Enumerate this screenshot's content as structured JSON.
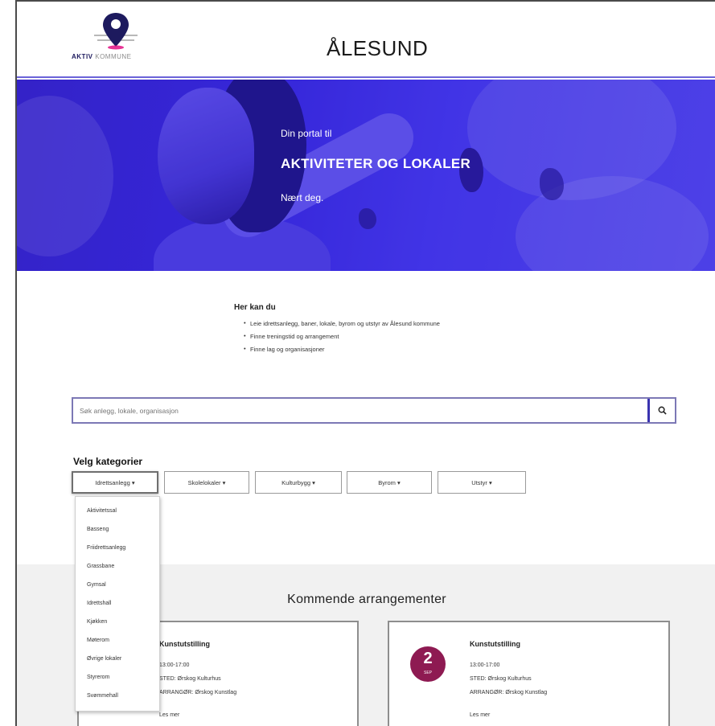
{
  "header": {
    "logo_brand": "AKTIV",
    "logo_sub": "KOMMUNE",
    "site_title": "ÅLESUND"
  },
  "hero": {
    "subtitle": "Din portal til",
    "title": "AKTIVITETER OG LOKALER",
    "tagline": "Nært deg."
  },
  "intro": {
    "heading": "Her kan du",
    "items": [
      "Leie idrettsanlegg, baner, lokale, byrom og utstyr av Ålesund kommune",
      "Finne treningstid og arrangement",
      "Finne lag og organisasjoner"
    ]
  },
  "search": {
    "placeholder": "Søk anlegg, lokale, organisasjon",
    "icon": "search-icon"
  },
  "categories": {
    "heading": "Velg kategorier",
    "buttons": [
      "Idrettsanlegg ▾",
      "Skolelokaler ▾",
      "Kulturbygg ▾",
      "Byrom ▾",
      "Utstyr ▾"
    ],
    "dropdown_items": [
      "Aktivitetssal",
      "Basseng",
      "Friidrettsanlegg",
      "Grassbane",
      "Gymsal",
      "Idrettshall",
      "Kjøkken",
      "Møterom",
      "Øvrige lokaler",
      "Styrerom",
      "Svømmehall"
    ]
  },
  "events": {
    "title": "Kommende arrangementer",
    "cards": [
      {
        "title": "Kunstutstilling",
        "time": "13:00-17:00",
        "place": "STED: Ørskog Kulturhus",
        "organizer": "ARRANGØR: Ørskog Kunstlag",
        "more": "Les mer"
      },
      {
        "day": "2",
        "month": "SEP",
        "title": "Kunstutstilling",
        "time": "13:00-17:00",
        "place": "STED: Ørskog Kulturhus",
        "organizer": "ARRANGØR: Ørskog Kunstlag",
        "more": "Les mer"
      }
    ]
  },
  "colors": {
    "accent": "#3b2ce0",
    "date_badge": "#8e1a52",
    "events_bg": "#f1f1f1"
  }
}
